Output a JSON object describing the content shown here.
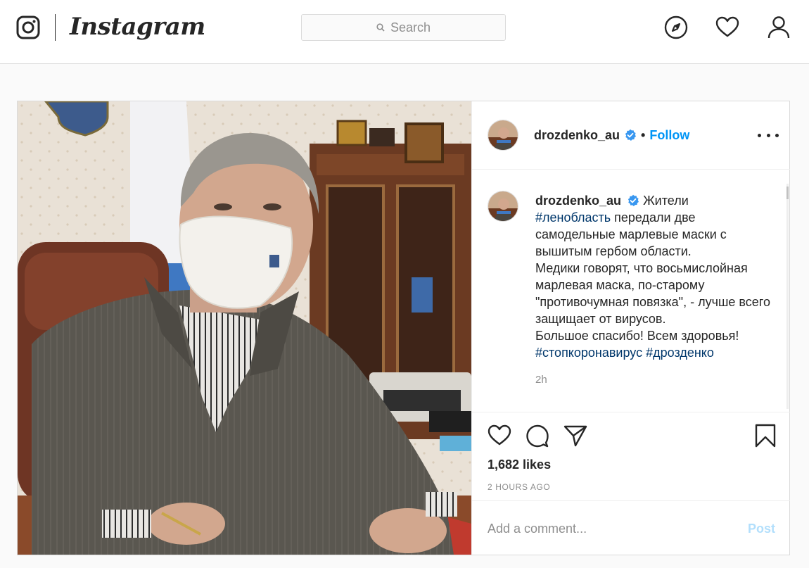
{
  "nav": {
    "brand": "Instagram",
    "search_placeholder": "Search",
    "icons": [
      "explore-compass-icon",
      "activity-heart-icon",
      "profile-icon"
    ]
  },
  "post": {
    "username": "drozdenko_au",
    "verified": true,
    "separator": "•",
    "follow_label": "Follow",
    "caption": {
      "username": "drozdenko_au",
      "line1": "Жители",
      "hashtag1": "#ленобласть",
      "text1": "передали две самодельные марлевые маски с вышитым гербом области.",
      "text2": "Медики говорят, что восьмислойная марлевая маска, по-старому \"противочумная повязка\", - лучше всего защищает от вирусов.",
      "text3": "Большое спасибо! Всем здоровья!",
      "hashtag2": "#стопкоронавирус",
      "hashtag3": "#дрозденко"
    },
    "caption_time": "2h",
    "likes": "1,682 likes",
    "time_ago": "2 HOURS AGO",
    "comment_placeholder": "Add a comment...",
    "post_label": "Post"
  },
  "colors": {
    "accent_blue": "#0095f6",
    "hashtag": "#00376b",
    "post_disabled": "#b2dffc",
    "border": "#dbdbdb"
  }
}
